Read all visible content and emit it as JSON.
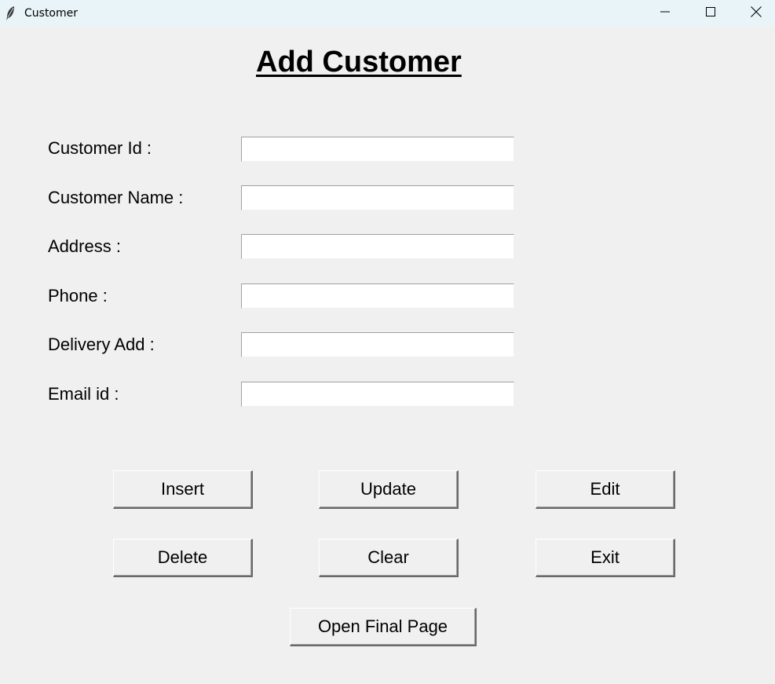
{
  "window": {
    "title": "Customer",
    "icon": "feather-icon",
    "controls": [
      "minimize-icon",
      "maximize-icon",
      "close-icon"
    ]
  },
  "form": {
    "heading": "Add Customer",
    "fields": [
      {
        "label": "Customer Id :",
        "value": ""
      },
      {
        "label": "Customer Name :",
        "value": ""
      },
      {
        "label": "Address :",
        "value": ""
      },
      {
        "label": "Phone :",
        "value": ""
      },
      {
        "label": "Delivery Add :",
        "value": ""
      },
      {
        "label": "Email id :",
        "value": ""
      }
    ]
  },
  "buttons": {
    "insert": "Insert",
    "update": "Update",
    "edit": "Edit",
    "delete": "Delete",
    "clear": "Clear",
    "exit": "Exit",
    "open_final_page": "Open Final Page"
  }
}
